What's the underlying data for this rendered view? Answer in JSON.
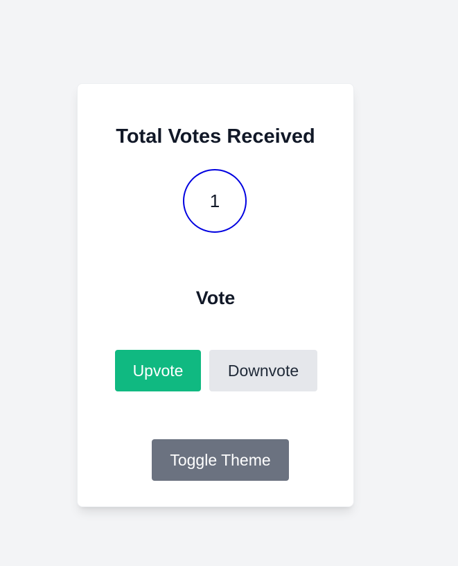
{
  "card": {
    "title": "Total Votes Received",
    "vote_count": "1",
    "vote_heading": "Vote"
  },
  "buttons": {
    "upvote_label": "Upvote",
    "downvote_label": "Downvote",
    "toggle_theme_label": "Toggle Theme"
  },
  "colors": {
    "background": "#f3f4f6",
    "card": "#ffffff",
    "counter_ring": "#0000e0",
    "upvote": "#10b981",
    "downvote": "#e5e7eb",
    "toggle_theme": "#6b7280"
  }
}
